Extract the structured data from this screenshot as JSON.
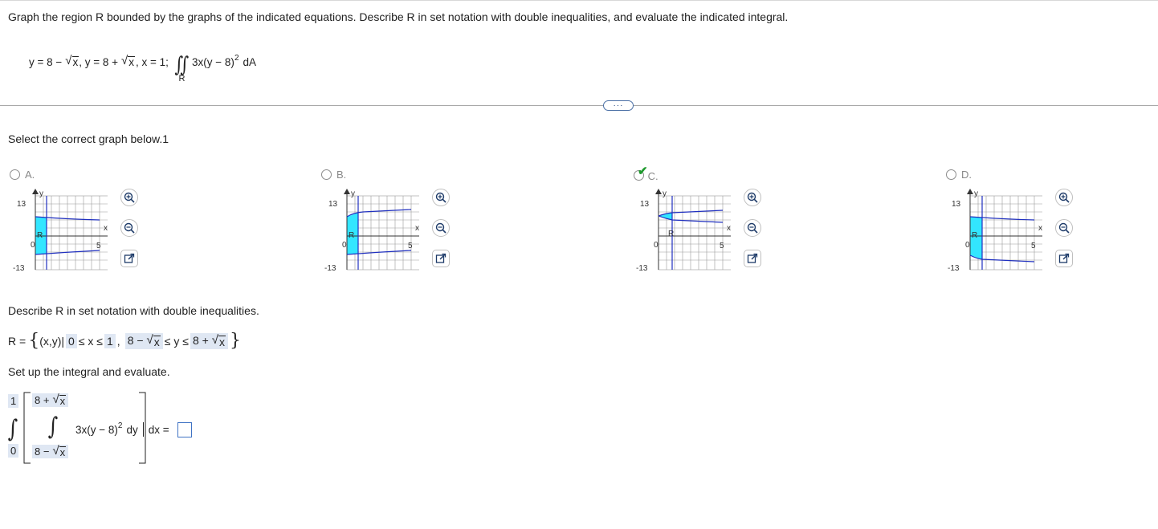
{
  "problem": {
    "instruction": "Graph the region R bounded by the graphs of the indicated equations. Describe R in set notation with double inequalities, and evaluate the indicated integral.",
    "eq1_prefix": "y = 8 −",
    "sqrt_x": "x",
    "eq2_prefix": ", y = 8 +",
    "eq3": ", x = 1;",
    "integrand": "3x(y − 8)",
    "integrand_power": "2",
    "differential": "dA",
    "region_label": "R"
  },
  "toolbar": {
    "more_label": "···"
  },
  "select_graph": {
    "label": "Select the correct graph below.1",
    "options": [
      {
        "letter": "A.",
        "y_max": "13",
        "y_min": "-13",
        "x_label": "x",
        "y_label": "y",
        "x_tick": "5",
        "origin": "0",
        "region": "R",
        "selected": false
      },
      {
        "letter": "B.",
        "y_max": "13",
        "y_min": "-13",
        "x_label": "x",
        "y_label": "y",
        "x_tick": "5",
        "origin": "0",
        "region": "R",
        "selected": false
      },
      {
        "letter": "C.",
        "y_max": "13",
        "y_min": "-13",
        "x_label": "x",
        "y_label": "y",
        "x_tick": "5",
        "origin": "0",
        "region": "R",
        "selected": true
      },
      {
        "letter": "D.",
        "y_max": "13",
        "y_min": "-13",
        "x_label": "x",
        "y_label": "y",
        "x_tick": "5",
        "origin": "0",
        "region": "R",
        "selected": false
      }
    ]
  },
  "set_notation": {
    "prompt": "Describe R in set notation with double inequalities.",
    "prefix": "R =",
    "set_start": "(x,y)|",
    "x_lower": "0",
    "x_mid": "≤ x ≤",
    "x_upper": "1",
    "comma": ",",
    "y_lower_prefix": "8 −",
    "y_mid": "≤ y ≤",
    "y_upper_prefix": "8 +"
  },
  "setup": {
    "prompt": "Set up the integral and evaluate.",
    "outer_upper": "1",
    "outer_lower": "0",
    "inner_upper_prefix": "8 +",
    "inner_lower_prefix": "8 −",
    "integrand": "3x(y − 8)",
    "integrand_power": "2",
    "inner_diff": "dy",
    "outer_diff": "dx =",
    "answer_value": ""
  },
  "colors": {
    "region_fill": "#33e6ff",
    "curve": "#1f2fbf",
    "check": "#1f9a2e",
    "input_border": "#3f73c4",
    "answer_box_bg": "#dfe7f3"
  }
}
